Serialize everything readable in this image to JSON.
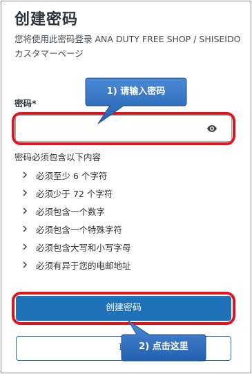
{
  "page": {
    "title": "创建密码",
    "subtitle": "您将使用此密码登录 ANA DUTY FREE SHOP / SHISEIDO カスタマーページ"
  },
  "password": {
    "label": "密码*",
    "value": "",
    "placeholder": "",
    "toggle_icon": "eye-icon"
  },
  "requirements": {
    "title": "密码必须包含以下内容",
    "items": [
      "必须至少 6 个字符",
      "必须少于 72 个字符",
      "必须包含一个数字",
      "必须包含一个特殊字符",
      "必须包含大写和小写字母",
      "必须有异于您的电邮地址"
    ]
  },
  "actions": {
    "create_label": "创建密码",
    "secondary_label": "取"
  },
  "annotations": {
    "step1": "1) 请输入密码",
    "step2": "2) 点击这里"
  },
  "colors": {
    "accent": "#1f71b8",
    "highlight": "#e0141c",
    "callout_fill": "#2f6fc0"
  }
}
